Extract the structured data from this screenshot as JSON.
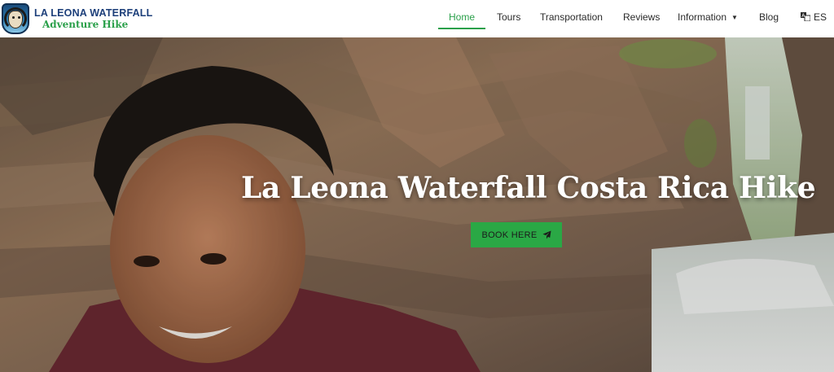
{
  "brand": {
    "line1": "LA LEONA WATERFALL",
    "line2": "Adventure Hike",
    "logo_icon": "lion-shield-logo"
  },
  "nav": {
    "items": [
      {
        "label": "Home",
        "active": true
      },
      {
        "label": "Tours",
        "active": false
      },
      {
        "label": "Transportation",
        "active": false
      },
      {
        "label": "Reviews",
        "active": false
      },
      {
        "label": "Information",
        "active": false,
        "has_dropdown": true
      },
      {
        "label": "Blog",
        "active": false
      }
    ],
    "language": {
      "label": "ES",
      "icon": "translate-icon"
    }
  },
  "hero": {
    "title": "La Leona Waterfall Costa Rica Hike",
    "button_label": "BOOK HERE",
    "button_icon": "paper-plane-icon"
  },
  "colors": {
    "accent": "#2aa04a",
    "brand_blue": "#1d3f7a",
    "button": "#2aa845"
  }
}
